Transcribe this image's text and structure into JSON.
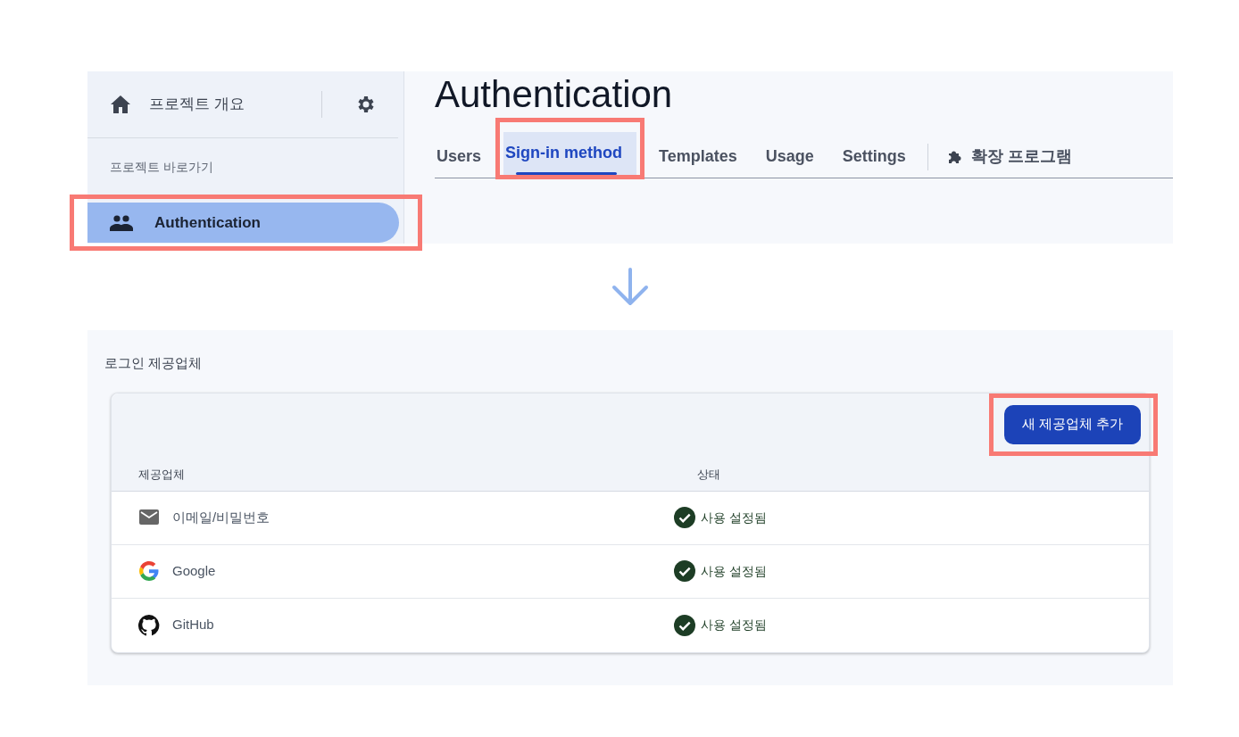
{
  "sidebar": {
    "overview_label": "프로젝트 개요",
    "section_title": "프로젝트 바로가기",
    "items": [
      {
        "label": "Authentication",
        "selected": true,
        "highlighted": true
      }
    ]
  },
  "main": {
    "title": "Authentication",
    "tabs": [
      {
        "label": "Users",
        "selected": false,
        "highlighted": false
      },
      {
        "label": "Sign-in method",
        "selected": true,
        "highlighted": true
      },
      {
        "label": "Templates",
        "selected": false,
        "highlighted": false
      },
      {
        "label": "Usage",
        "selected": false,
        "highlighted": false
      },
      {
        "label": "Settings",
        "selected": false,
        "highlighted": false
      }
    ],
    "extensions_tab": {
      "label": "확장 프로그램"
    }
  },
  "providers_section": {
    "title": "로그인 제공업체",
    "add_button": {
      "label": "새 제공업체 추가",
      "highlighted": true
    },
    "columns": [
      "제공업체",
      "상태"
    ],
    "rows": [
      {
        "kind": "email",
        "name": "이메일/비밀번호",
        "enabled": true,
        "status": "사용 설정됨"
      },
      {
        "kind": "google",
        "name": "Google",
        "enabled": true,
        "status": "사용 설정됨"
      },
      {
        "kind": "github",
        "name": "GitHub",
        "enabled": true,
        "status": "사용 설정됨"
      }
    ]
  }
}
